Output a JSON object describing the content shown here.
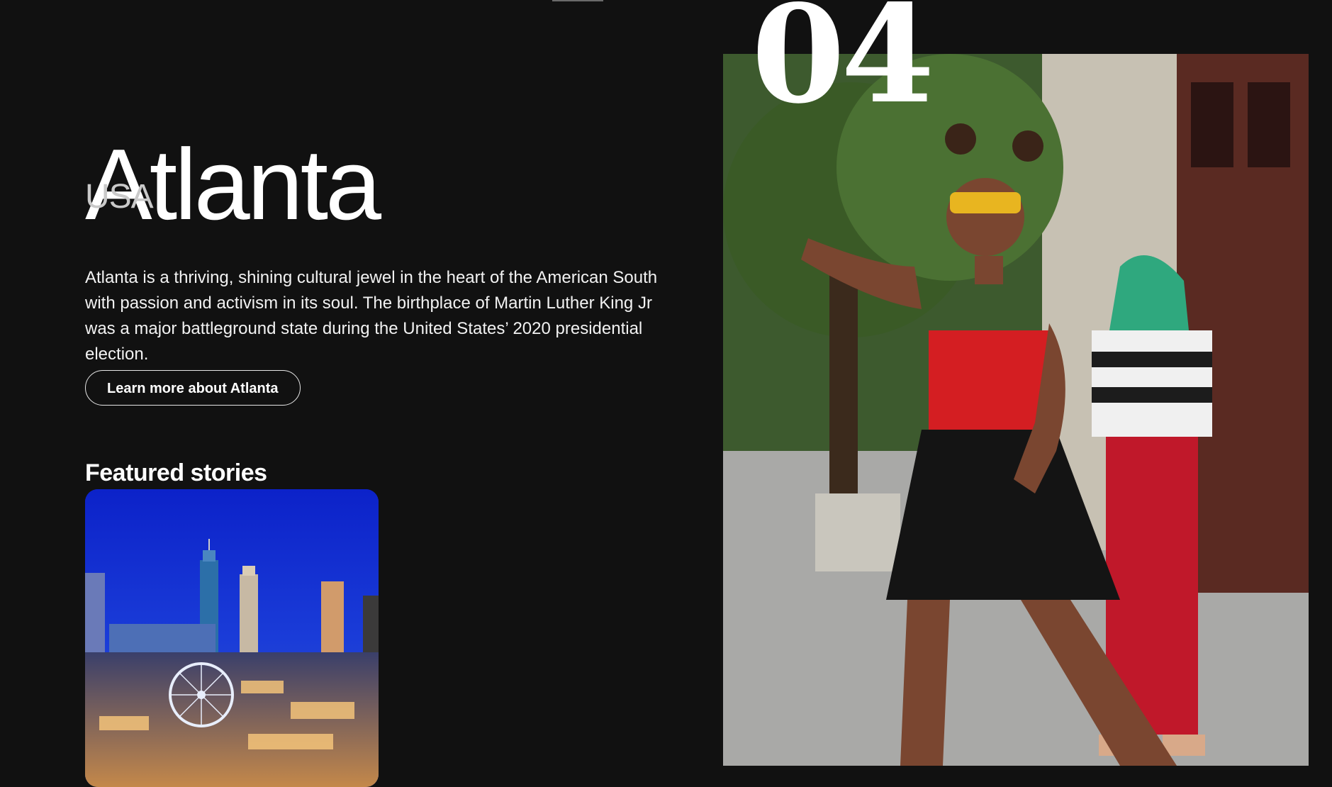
{
  "city": {
    "name": "Atlanta",
    "country": "USA",
    "description": "Atlanta is a thriving, shining cultural jewel in the heart of the American South with passion and activism in its soul. The birthplace of Martin Luther King Jr was a major battleground state during the United States’ 2020 presidential election.",
    "learn_more_label": "Learn more about Atlanta"
  },
  "featured": {
    "heading": "Featured stories"
  },
  "hero": {
    "index": "04"
  },
  "colors": {
    "background": "#111111",
    "text": "#ffffff"
  }
}
